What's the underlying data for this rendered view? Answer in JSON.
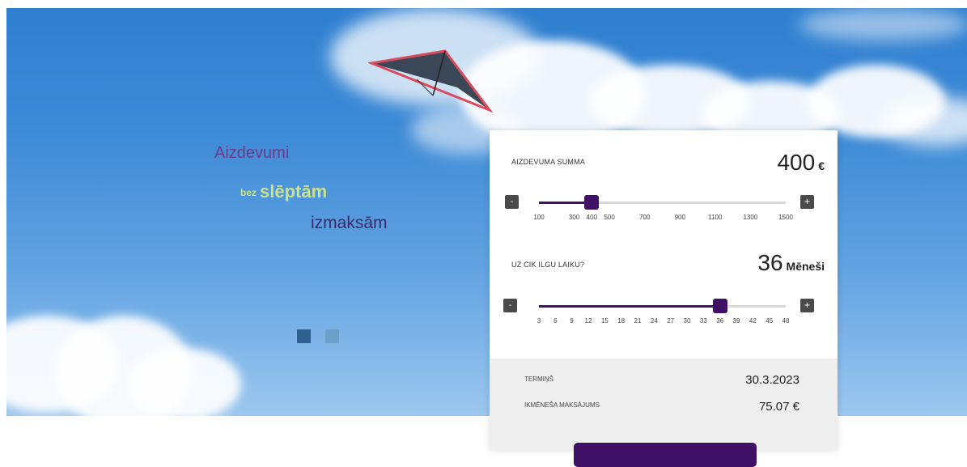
{
  "hero": {
    "headline_line1": "Aizdevumi",
    "headline_line2_prefix": "bez",
    "headline_line2_main": "slēptām",
    "headline_line3": "izmaksām",
    "slides": [
      {
        "active": true
      },
      {
        "active": false
      }
    ]
  },
  "calculator": {
    "amount": {
      "label": "AIZDEVUMA SUMMA",
      "value": "400",
      "unit": "€",
      "min": 100,
      "max": 1500,
      "current": 400,
      "ticks": [
        "100",
        "300",
        "400",
        "500",
        "700",
        "900",
        "1100",
        "1300",
        "1500"
      ]
    },
    "term": {
      "label": "UZ CIK ILGU LAIKU?",
      "value": "36",
      "unit": "Mēneši",
      "min": 3,
      "max": 48,
      "current": 36,
      "ticks": [
        "3",
        "6",
        "9",
        "12",
        "15",
        "18",
        "21",
        "24",
        "27",
        "30",
        "33",
        "36",
        "39",
        "42",
        "45",
        "48"
      ]
    },
    "decrease_label": "-",
    "increase_label": "+",
    "summary": {
      "term_label": "TERMIŅŠ",
      "term_value": "30.3.2023",
      "payment_label": "IKMĒNEŠA MAKSĀJUMS",
      "payment_value": "75.07 €"
    }
  },
  "colors": {
    "accent": "#3e1066",
    "headline_purple": "#6b3a8a",
    "headline_green": "#cbe28c"
  }
}
